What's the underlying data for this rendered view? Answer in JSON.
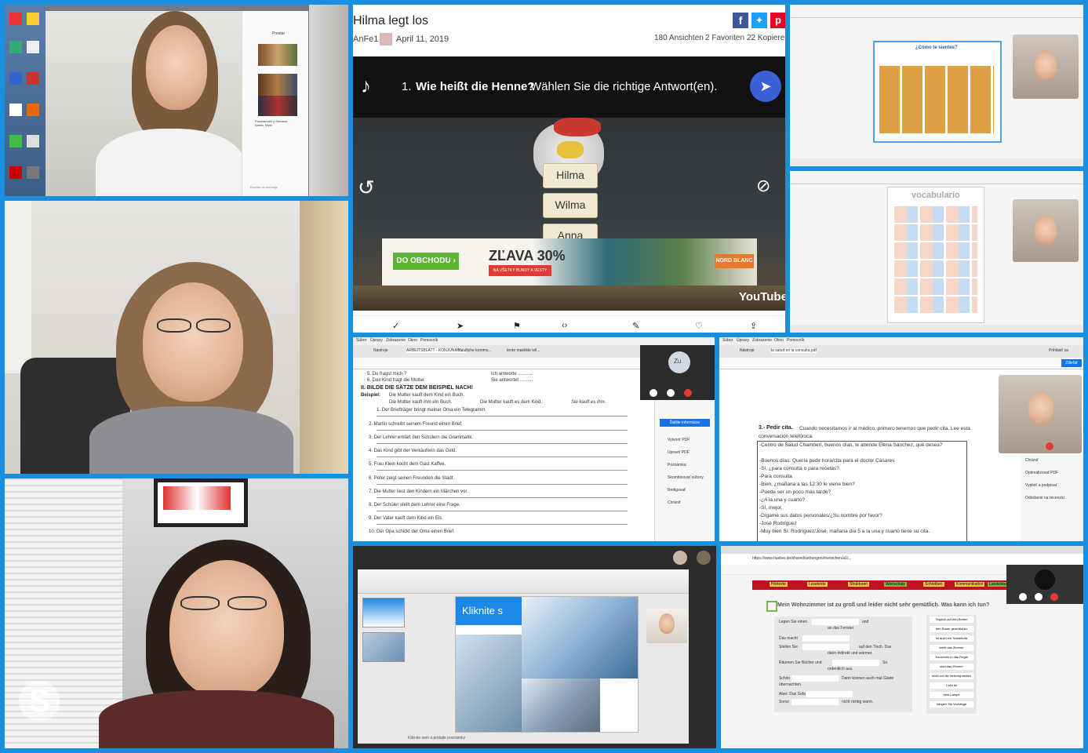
{
  "colors": {
    "frame": "#1a8fe0",
    "accent_blue": "#3b5fd6",
    "yt_dark": "#111111",
    "green_btn": "#5cb531",
    "red_call": "#e53935"
  },
  "quiz": {
    "title": "Hilma legt los",
    "author": "AnFe1",
    "date": "April 11, 2019",
    "views": "180 Ansichten",
    "favorites": "2 Favoriten",
    "copies": "22 Kopieren",
    "question_number": "1.",
    "question_bold": "Wie heißt die Henne?",
    "question_rest": "Wählen Sie die richtige Antwort(en).",
    "answers": [
      "Hilma",
      "Wilma",
      "Anna"
    ],
    "ad_button": "DO OBCHODU ›",
    "ad_sale": "ZĽAVA 30%",
    "ad_sub": "NA VŠETKY BUNDY A VESTY",
    "ad_brand": "NORD BLANC",
    "youtube": "YouTube",
    "icons": [
      "music-note-icon",
      "send-icon",
      "replay-icon",
      "hide-eye-icon",
      "facebook-icon",
      "twitter-icon",
      "pinterest-icon"
    ]
  },
  "worksheet_de": {
    "tabs": [
      "ARBEITSBLATT - KONJUNKTIV...",
      "mundliche kommu...",
      "tente maktikle lell..."
    ],
    "menu": [
      "Súbor",
      "Úpravy",
      "Zobrazenie",
      "Okno",
      "Pomocník"
    ],
    "toolbar_left": "Nástroje",
    "line_a": "5. Du fragst mich ?",
    "line_a2": "Ich antworte ...........",
    "line_b": "6. Das Kind fragt die Mutter.",
    "line_b2": "Sie antwortet ..........",
    "heading": "II. BILDE DIE SÄTZE DEM BEISPIEL NACH!",
    "example_label": "Beispiel:",
    "example_1": "Die Mutter kauft dem Kind ein Buch.",
    "example_2": "Die Mutter kauft ihm ein Buch.",
    "example_3": "Die Mutter kauft es dem Kind.",
    "example_4": "Sie kauft es ihm.",
    "sentences": [
      "1. Der Briefträger bringt meiner Oma ein Telegramm.",
      "2. Martin schreibt seinem Freund einen Brief.",
      "3. Der Lehrer erklärt den Schülern die Grammatik.",
      "4. Das Kind gibt der Verkäuferin das Geld.",
      "5. Frau Klein kocht dem Gast Kaffee.",
      "6. Peter zeigt seinen Freunden die Stadt.",
      "7. Die Mutter liest den Kindern ein Märchen vor.",
      "8. Der Schüler stellt dem Lehrer eine Frage.",
      "9. Der Vater kauft dem Kind ein Eis.",
      "10. Der Opa schickt der Oma einen Brief."
    ],
    "side_panel": [
      "Vytvoriť PDF",
      "Upraviť PDF",
      "Poznámka",
      "Skombinovať súbory",
      "Redigovať",
      "Chrániť"
    ],
    "side_button": "Ďalšie informácie",
    "avatar_label": "Zu"
  },
  "worksheet_es": {
    "menu": [
      "Súbor",
      "Úpravy",
      "Zobrazenie",
      "Okno",
      "Pomocník"
    ],
    "toolbar_left": "Nástroje",
    "tab": "la salud en la consulta.pdf",
    "sign_in": "Prihlásiť sa",
    "share": "Zdieľať",
    "heading": "3.- Pedir cita.",
    "intro": "Cuando necesitamos ir al médico, primero tenemos que pedir cita. Lee esta conversación telefónica:",
    "dialog": [
      "-Centro de Salud Chamberí, buenos días, le atiende Elena Sánchez, qué desea?",
      "-Buenos días. Quería pedir hora/cita para el doctor Casares",
      "-Sí, ¿para consulta o para recetas?",
      "-Para consulta",
      "-Bien, ¿mañana a las 12:30 le viene bien?",
      "-Puede ser un poco más tarde?",
      "-¿A la una y cuarto?",
      "-Sí, mejor.",
      "-Dígame sus datos personales/¿Su nombre por favor?",
      "-José Rodríguez",
      "-Muy bien Sr. Rodríguez/José, mañana día 5 a la una y cuarto tiene su cita."
    ],
    "side_panel": [
      "Chrániť",
      "Optimalizovať PDF",
      "Vyplniť a podpísať",
      "Odoslanie na recenziu"
    ]
  },
  "slides_top": {
    "title": "¿Cómo te sientes?"
  },
  "slides_mid": {
    "title": "vocabulario"
  },
  "ppt": {
    "slide_text": "Kliknite s",
    "status": "Kliknite sem a pridajte poznámky"
  },
  "wohnung": {
    "title": "Mein Wohnzimmer ist zu groß und leider nicht sehr gemütlich. Was kann ich tun?",
    "menu": [
      "Hörtexte",
      "Lesetexte",
      "Strukturen",
      "Wortschatz",
      "Schreiben",
      "Kommunikation",
      "Landeskunde"
    ],
    "sentences": [
      "Legen Sie einen",
      "Das macht",
      "Stellen Sie",
      "Räumen Sie Bücher und",
      "Schön",
      "Aber: Das Sofa",
      "Sonst"
    ],
    "fragments": [
      "und",
      "an das Fenster",
      "auf den Tisch. Das",
      "dann indirekt und wärmer.",
      "So",
      "ordentlich aus.",
      "Dann können auch mal Gäste",
      "übernachten.",
      "nicht richtig warm."
    ],
    "options": [
      "Teppich auf den Boden",
      "den Raum gemütlicher",
      "ist auch ein Schlafsofa",
      "steht das Zimmer",
      "Souvenirs in das Regal",
      "sind das Zimmer",
      "nicht vor die Heizung stellen",
      "Licht ist",
      "eine Lampe",
      "hängen Sie Vorhänge"
    ],
    "url": "https://www.hueber.de/shared/uebungen/menschen/a1/..."
  },
  "desktop_chat": {
    "heading": "Prestar",
    "card_title": "Procesiones y Semana Santa, Nivel",
    "input_placeholder": "Escribe un mensaje"
  }
}
